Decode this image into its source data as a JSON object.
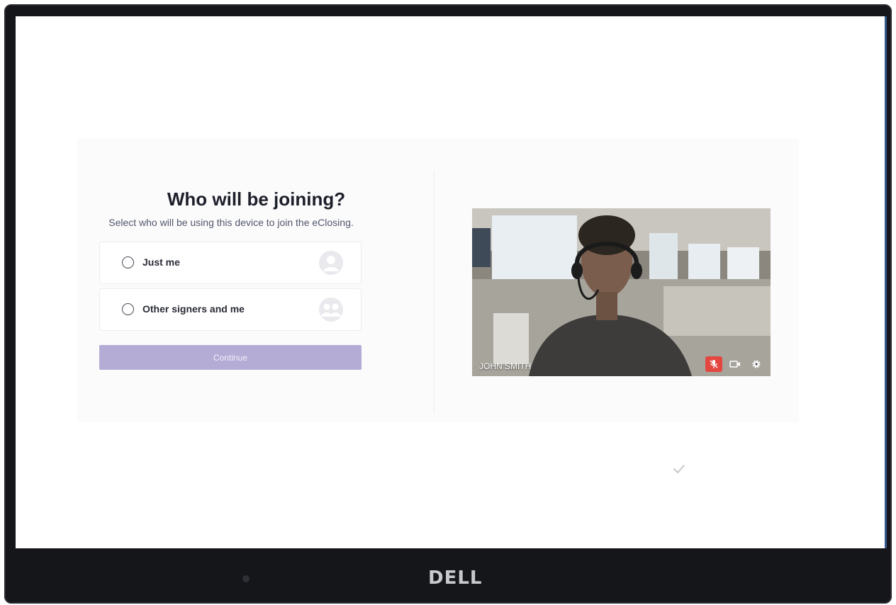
{
  "card": {
    "title": "Who will be joining?",
    "subtitle": "Select who will be using this device to join the eClosing.",
    "options": [
      {
        "label": "Just me",
        "icon": "single-user-icon",
        "selected": false
      },
      {
        "label": "Other signers and me",
        "icon": "group-users-icon",
        "selected": false
      }
    ],
    "continue_label": "Continue"
  },
  "video": {
    "participant_name": "JOHN SMITH",
    "mic_muted": true,
    "icons": [
      "mic-muted-icon",
      "camera-icon",
      "settings-icon"
    ]
  },
  "device": {
    "brand": "DELL"
  },
  "colors": {
    "accent_disabled": "#b5acd6",
    "mute_red": "#e4473f",
    "title": "#1d1f2a"
  }
}
